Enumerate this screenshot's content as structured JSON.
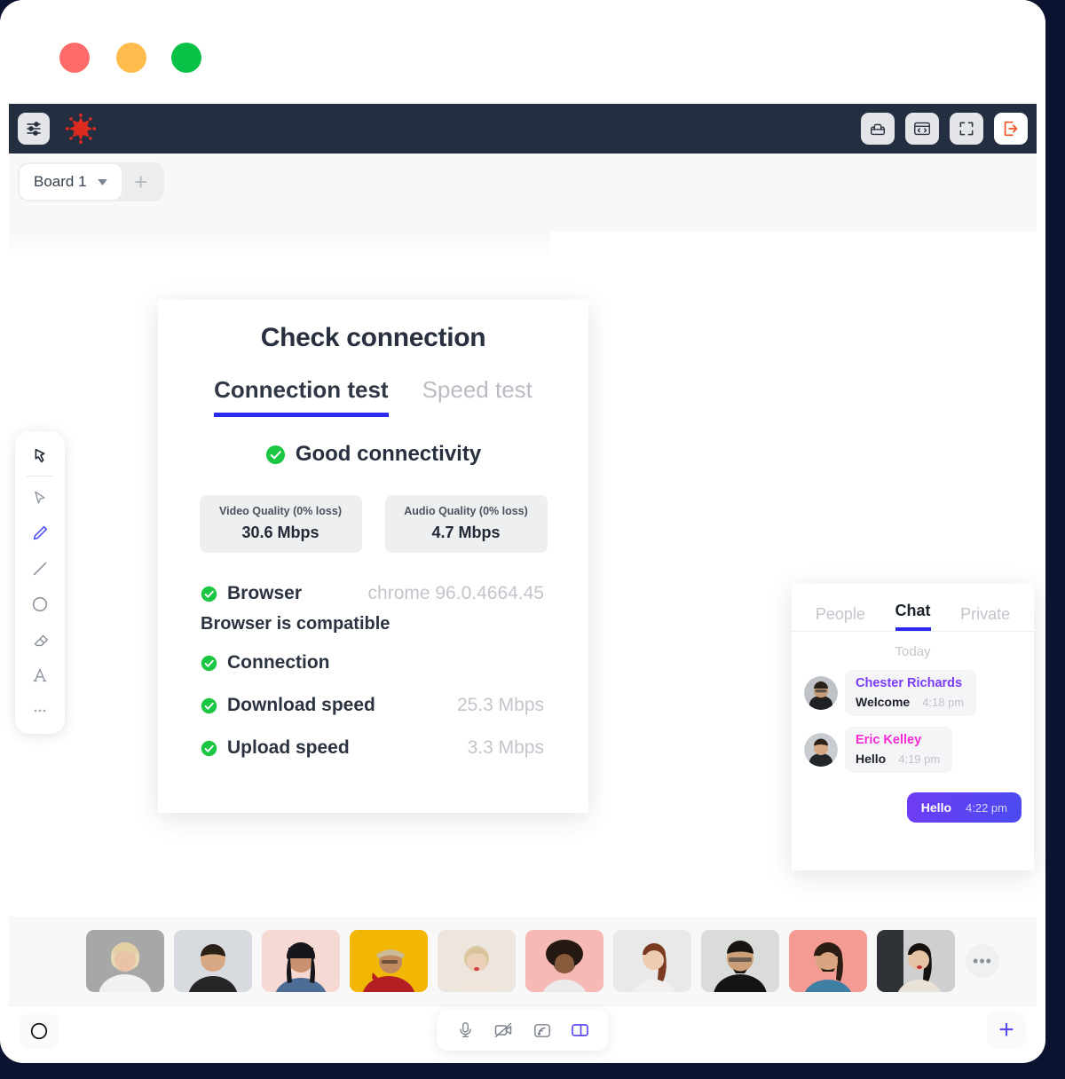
{
  "window": {
    "traffic_lights": [
      {
        "name": "close",
        "color": "#ff6b6b"
      },
      {
        "name": "minimize",
        "color": "#ffbc4c"
      },
      {
        "name": "maximize",
        "color": "#0ac148"
      }
    ]
  },
  "toolbar": {
    "settings_icon": "sliders-icon",
    "brand_icon": "snowflake-logo",
    "brand_color": "#e02b20",
    "right_buttons": [
      {
        "name": "lounge-button",
        "icon": "sofa-icon"
      },
      {
        "name": "embed-code-button",
        "icon": "code-window-icon"
      },
      {
        "name": "fullscreen-button",
        "icon": "expand-icon"
      },
      {
        "name": "leave-button",
        "icon": "exit-icon",
        "color": "#f4511e"
      }
    ]
  },
  "boards": {
    "active_tab": "Board 1",
    "dropdown_icon": "chevron-down-icon",
    "add_label": "+"
  },
  "draw_tools": [
    {
      "name": "pin-tool",
      "icon": "pin-icon",
      "active": false
    },
    {
      "name": "select-tool",
      "icon": "cursor-icon",
      "active": false
    },
    {
      "name": "pencil-tool",
      "icon": "pencil-icon",
      "active": true
    },
    {
      "name": "line-tool",
      "icon": "line-icon",
      "active": false
    },
    {
      "name": "circle-tool",
      "icon": "circle-icon",
      "active": false
    },
    {
      "name": "eraser-tool",
      "icon": "eraser-icon",
      "active": false
    },
    {
      "name": "text-tool",
      "icon": "text-a-icon",
      "active": false
    },
    {
      "name": "more-tools",
      "icon": "ellipsis-icon",
      "active": false
    }
  ],
  "connection_card": {
    "title": "Check connection",
    "tabs": [
      {
        "label": "Connection test",
        "active": true
      },
      {
        "label": "Speed test",
        "active": false
      }
    ],
    "status": {
      "icon": "check-circle-icon",
      "text": "Good connectivity",
      "color": "#1bc742"
    },
    "quality": [
      {
        "label": "Video Quality (0% loss)",
        "value": "30.6 Mbps"
      },
      {
        "label": "Audio Quality (0% loss)",
        "value": "4.7 Mbps"
      }
    ],
    "rows": [
      {
        "label": "Browser",
        "value": "chrome 96.0.4664.45"
      },
      {
        "label": "Connection",
        "value": ""
      },
      {
        "label": "Download speed",
        "value": "25.3 Mbps"
      },
      {
        "label": "Upload speed",
        "value": "3.3 Mbps"
      }
    ],
    "browser_note": "Browser is compatible",
    "accent_color": "#2a2af0"
  },
  "chat": {
    "tabs": [
      {
        "label": "People",
        "active": false
      },
      {
        "label": "Chat",
        "active": true
      },
      {
        "label": "Private",
        "active": false
      }
    ],
    "date_divider": "Today",
    "messages": [
      {
        "name": "Chester Richards",
        "name_color": "#7a3bf5",
        "text": "Welcome",
        "time": "4:18 pm",
        "outgoing": false
      },
      {
        "name": "Eric Kelley",
        "name_color": "#f42ad2",
        "text": "Hello",
        "time": "4:19 pm",
        "outgoing": false
      }
    ],
    "outgoing": {
      "text": "Hello",
      "time": "4:22 pm"
    }
  },
  "participants": {
    "tiles": [
      {
        "name": "participant-1",
        "bg": "#a7a7a7",
        "skin": "#e8c3a6",
        "hair": "#e8d9b5",
        "shirt": "#f1f1f1"
      },
      {
        "name": "participant-2",
        "bg": "#d7dade",
        "skin": "#d7a882",
        "hair": "#2a2016",
        "shirt": "#262626"
      },
      {
        "name": "participant-3",
        "bg": "#f7d9d4",
        "skin": "#c99170",
        "hair": "#17161b",
        "shirt": "#4c6d96"
      },
      {
        "name": "participant-4",
        "bg": "#f2b705",
        "skin": "#c08b61",
        "hair": "#cbbb96",
        "shirt": "#b41f24"
      },
      {
        "name": "participant-5",
        "bg": "#ece6de",
        "skin": "#eccfb8",
        "hair": "#dcc9a2",
        "shirt": "#efe7dc"
      },
      {
        "name": "participant-6",
        "bg": "#f6b9b5",
        "skin": "#8a5a3c",
        "hair": "#241813",
        "shirt": "#ebebeb"
      },
      {
        "name": "participant-7",
        "bg": "#e9e9ea",
        "skin": "#edccb4",
        "hair": "#7c3a20",
        "shirt": "#f2f0ee"
      },
      {
        "name": "participant-8",
        "bg": "#d9dcd8",
        "skin": "#cc9f78",
        "hair": "#191410",
        "shirt": "#141414"
      },
      {
        "name": "participant-9",
        "bg": "#f49b94",
        "skin": "#d9a581",
        "hair": "#2b1d14",
        "shirt": "#3f7fa3"
      },
      {
        "name": "participant-10",
        "bg": "#cfcfd2",
        "skin": "#e7c3a6",
        "hair": "#15110e",
        "shirt": "#e9e2d6"
      }
    ],
    "more_label": "•••"
  },
  "bottom_bar": {
    "record_icon": "record-circle-icon",
    "media": [
      {
        "name": "microphone-button",
        "icon": "mic-icon",
        "active": false
      },
      {
        "name": "camera-button",
        "icon": "camera-off-icon",
        "active": false
      },
      {
        "name": "screenshare-button",
        "icon": "screen-share-icon",
        "active": false
      },
      {
        "name": "layout-button",
        "icon": "panel-layout-icon",
        "active": true
      }
    ],
    "add_label": "+",
    "accent_color": "#5b4bf5"
  }
}
